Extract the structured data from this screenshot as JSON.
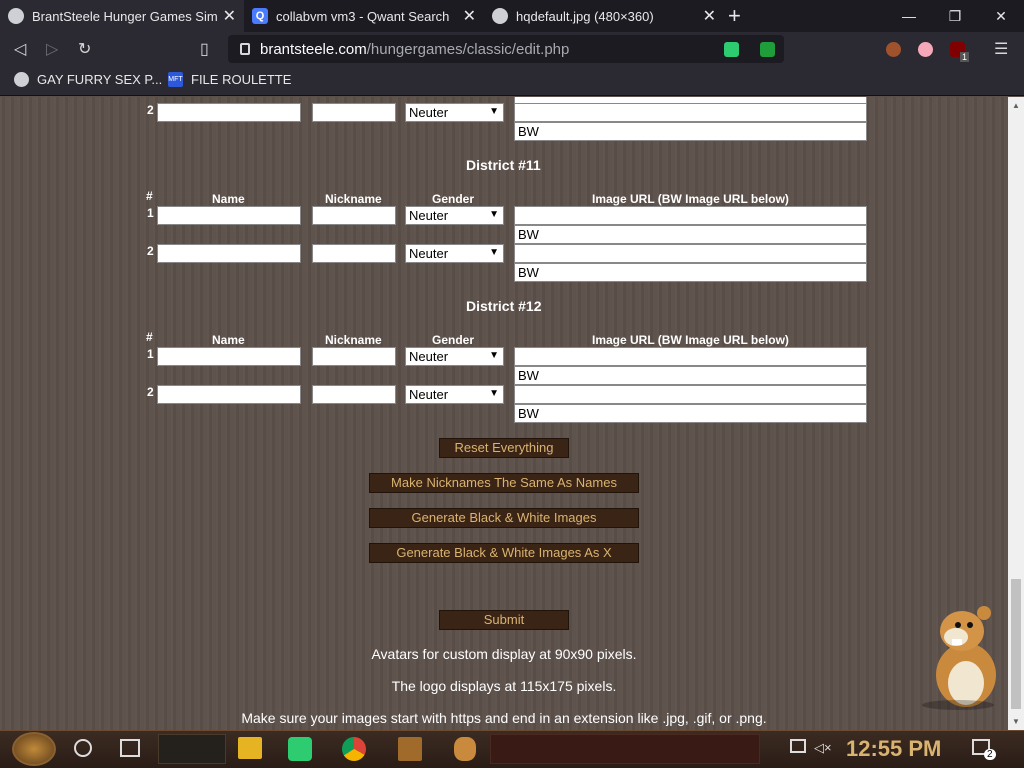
{
  "browser": {
    "tabs": [
      {
        "title": "BrantSteele Hunger Games Simul"
      },
      {
        "title": "collabvm vm3 - Qwant Search"
      },
      {
        "title": "hqdefault.jpg (480×360)"
      }
    ],
    "url_host": "brantsteele.com",
    "url_path": "/hungergames/classic/edit.php",
    "bookmarks": [
      {
        "label": "GAY FURRY SEX P..."
      },
      {
        "label": "FILE ROULETTE"
      }
    ],
    "qwant_icon": "Q",
    "mft_icon": "MFT",
    "ublock_count": "1"
  },
  "page": {
    "top_partial": {
      "row_num": "2",
      "gender": "Neuter",
      "bw_value": "BW"
    },
    "headers": {
      "num": "#",
      "name": "Name",
      "nickname": "Nickname",
      "gender": "Gender",
      "image_url": "Image URL (BW Image URL below)"
    },
    "districts": [
      {
        "title": "District #11",
        "rows": [
          {
            "num": "1",
            "gender": "Neuter",
            "bw": "BW"
          },
          {
            "num": "2",
            "gender": "Neuter",
            "bw": "BW"
          }
        ]
      },
      {
        "title": "District #12",
        "rows": [
          {
            "num": "1",
            "gender": "Neuter",
            "bw": "BW"
          },
          {
            "num": "2",
            "gender": "Neuter",
            "bw": "BW"
          }
        ]
      }
    ],
    "buttons": {
      "reset": "Reset Everything",
      "nicknames": "Make Nicknames The Same As Names",
      "bw": "Generate Black & White Images",
      "bw_x": "Generate Black & White Images As X",
      "submit": "Submit"
    },
    "notes": [
      "Avatars for custom display at 90x90 pixels.",
      "The logo displays at 115x175 pixels.",
      "Make sure your images start with https and end in an extension like .jpg, .gif, or .png."
    ]
  },
  "taskbar": {
    "clock": "12:55 PM",
    "notif_count": "2"
  },
  "colors": {
    "page_bg": "#5c504a",
    "button_bg": "#3a2415",
    "button_text": "#d9b370"
  }
}
